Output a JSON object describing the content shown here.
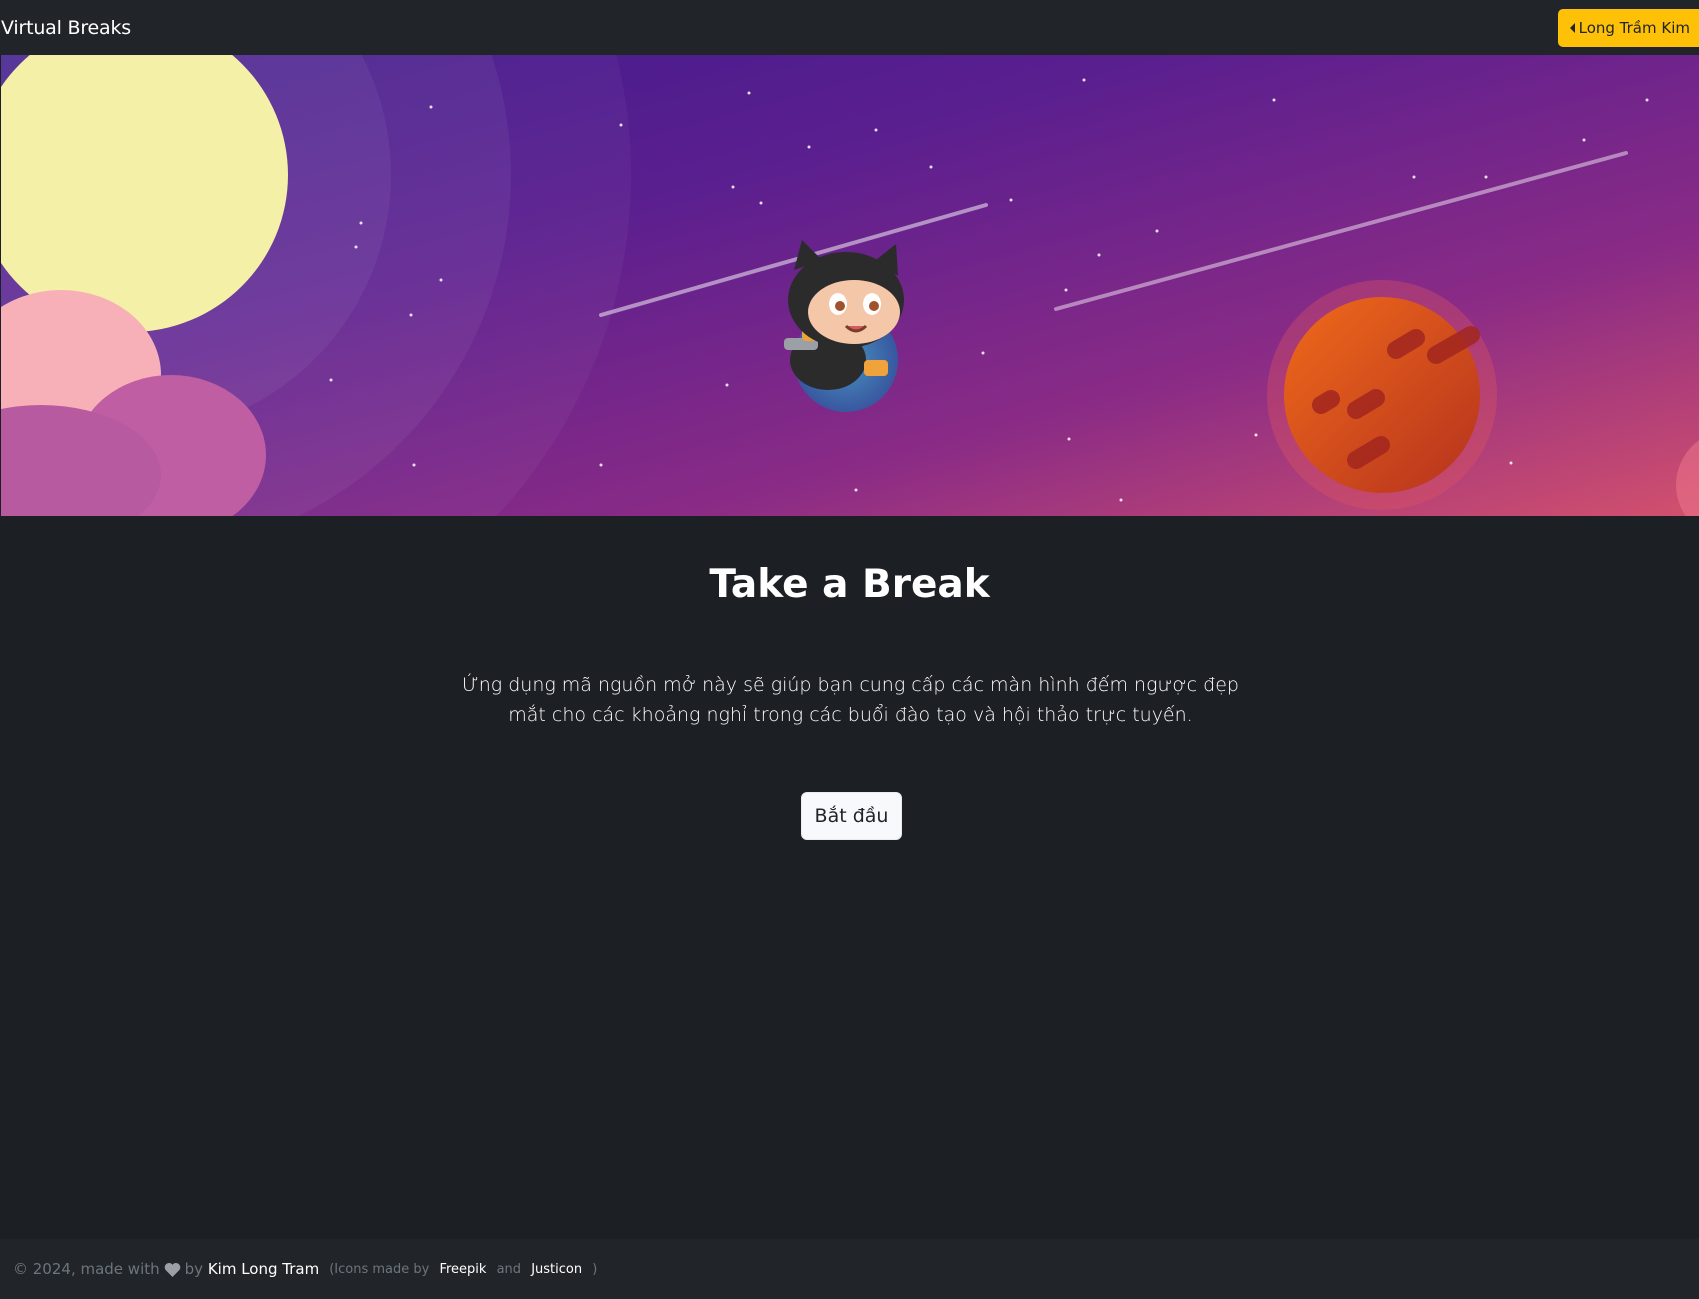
{
  "navbar": {
    "brand": "Virtual Breaks",
    "author_button": "Long Trầm Kim"
  },
  "hero": {
    "image_icon": "octocat-astronaut-space-illustration"
  },
  "main": {
    "title": "Take a Break",
    "description": "Ứng dụng mã nguồn mở này sẽ giúp bạn cung cấp các màn hình đếm ngược đẹp mắt cho các khoảng nghỉ trong các buổi đào tạo và hội thảo trực tuyến.",
    "start_button": "Bắt đầu"
  },
  "footer": {
    "copyright": "© 2024, made with",
    "by": "by",
    "author": "Kim Long Tram",
    "icons_open": "(Icons made by",
    "freepik": "Freepik",
    "and": "and",
    "justicon": "Justicon",
    "icons_close": ")"
  },
  "colors": {
    "accent": "#ffc107",
    "background": "#1c1f24",
    "navbar": "#212529"
  }
}
